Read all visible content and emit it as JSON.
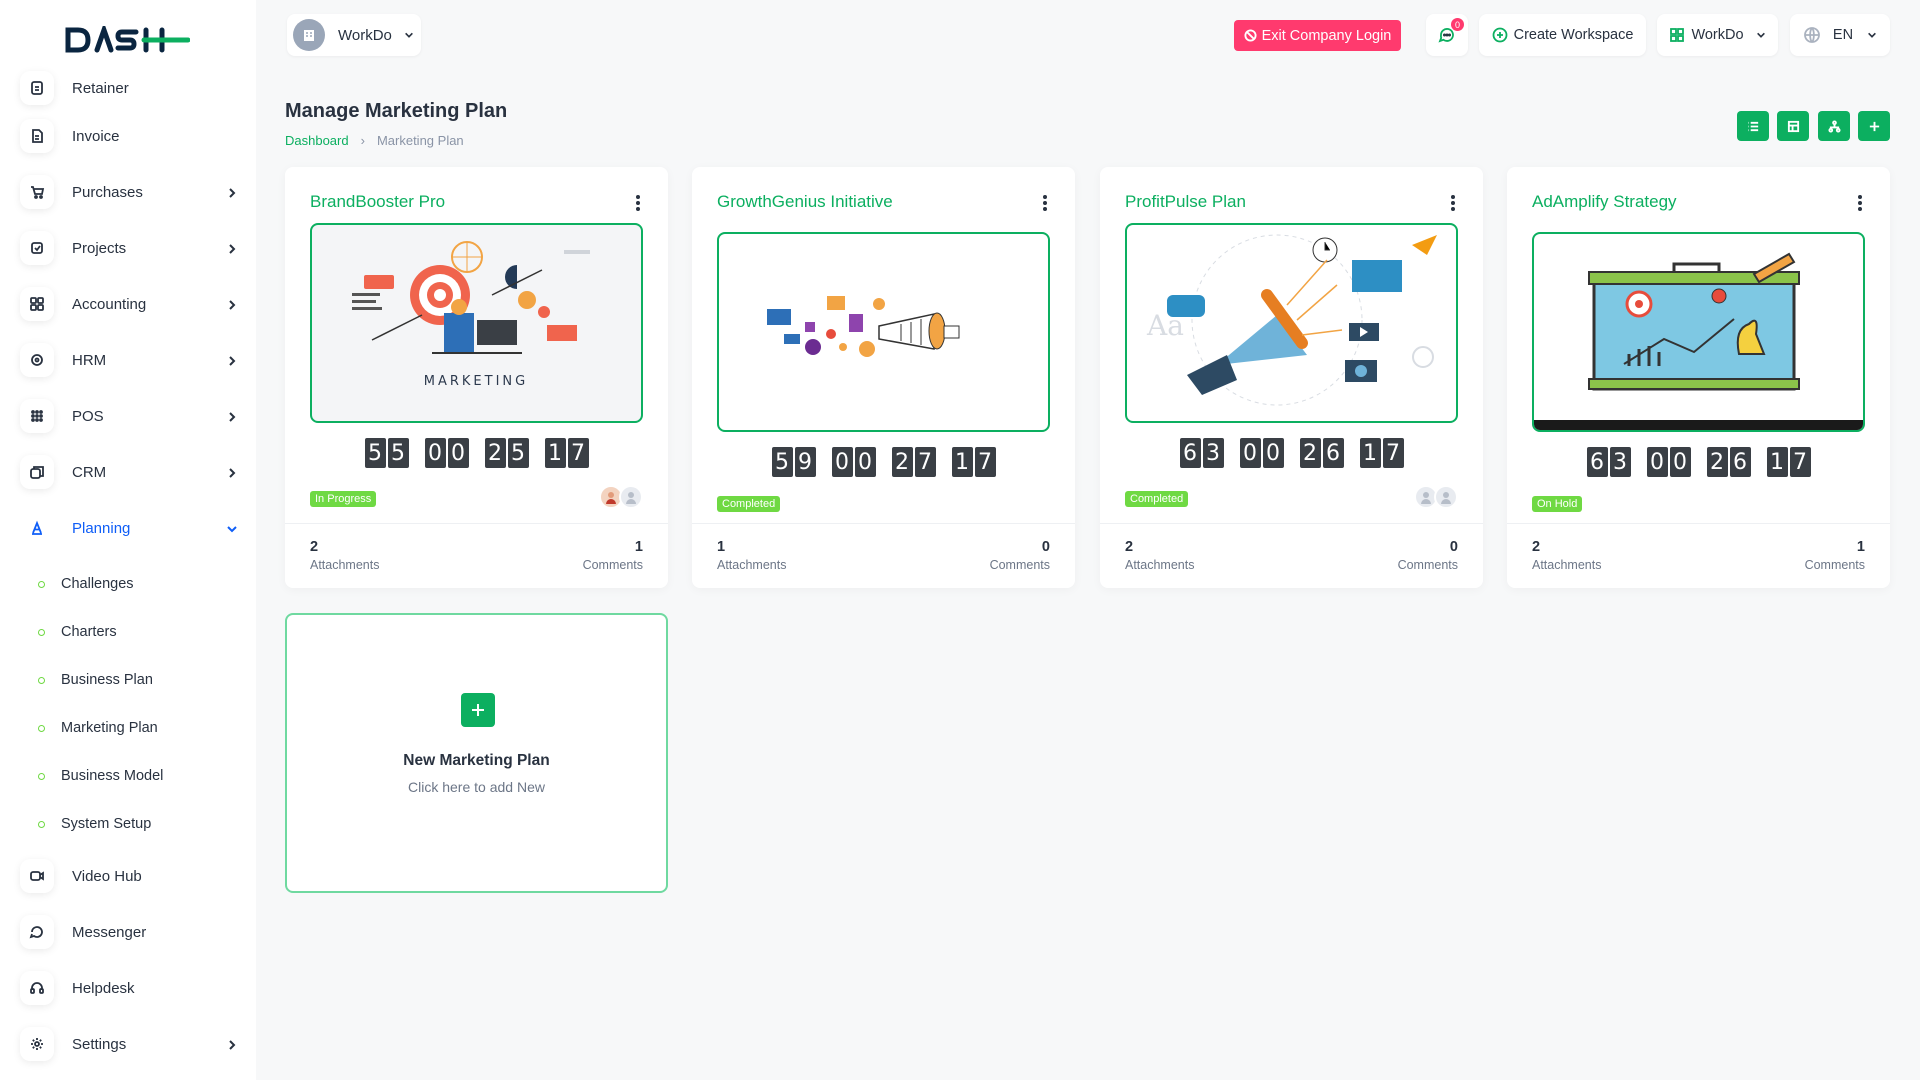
{
  "brand": {
    "logo_text": "DASH"
  },
  "sidebar": {
    "items": [
      {
        "label": "Retainer",
        "icon": "retainer-icon"
      },
      {
        "label": "Invoice",
        "icon": "invoice-icon"
      },
      {
        "label": "Purchases",
        "icon": "cart-icon"
      },
      {
        "label": "Projects",
        "icon": "projects-icon"
      },
      {
        "label": "Accounting",
        "icon": "accounting-icon"
      },
      {
        "label": "HRM",
        "icon": "hrm-icon"
      },
      {
        "label": "POS",
        "icon": "pos-icon"
      },
      {
        "label": "CRM",
        "icon": "crm-icon"
      },
      {
        "label": "Planning",
        "icon": "planning-icon"
      }
    ],
    "planning_sub": [
      {
        "label": "Challenges"
      },
      {
        "label": "Charters"
      },
      {
        "label": "Business Plan"
      },
      {
        "label": "Marketing Plan"
      },
      {
        "label": "Business Model"
      },
      {
        "label": "System Setup"
      }
    ],
    "bottom_items": [
      {
        "label": "Video Hub",
        "icon": "video-icon"
      },
      {
        "label": "Messenger",
        "icon": "messenger-icon"
      },
      {
        "label": "Helpdesk",
        "icon": "headset-icon"
      },
      {
        "label": "Settings",
        "icon": "gear-icon"
      }
    ]
  },
  "header": {
    "workspace": "WorkDo",
    "exit_label": "Exit Company Login",
    "notification_count": "0",
    "create_workspace": "Create Workspace",
    "workspace_menu": "WorkDo",
    "language": "EN"
  },
  "page": {
    "title": "Manage Marketing Plan",
    "breadcrumb": {
      "home": "Dashboard",
      "current": "Marketing Plan"
    }
  },
  "cards": [
    {
      "title": "BrandBooster Pro",
      "countdown": [
        "55",
        "00",
        "25",
        "17"
      ],
      "status": "In Progress",
      "attachments_count": "2",
      "attachments_label": "Attachments",
      "comments_count": "1",
      "comments_label": "Comments",
      "image_caption": "MARKETING"
    },
    {
      "title": "GrowthGenius Initiative",
      "countdown": [
        "59",
        "00",
        "27",
        "17"
      ],
      "status": "Completed",
      "attachments_count": "1",
      "attachments_label": "Attachments",
      "comments_count": "0",
      "comments_label": "Comments"
    },
    {
      "title": "ProfitPulse Plan",
      "countdown": [
        "63",
        "00",
        "26",
        "17"
      ],
      "status": "Completed",
      "attachments_count": "2",
      "attachments_label": "Attachments",
      "comments_count": "0",
      "comments_label": "Comments"
    },
    {
      "title": "AdAmplify Strategy",
      "countdown": [
        "63",
        "00",
        "26",
        "17"
      ],
      "status": "On Hold",
      "attachments_count": "2",
      "attachments_label": "Attachments",
      "comments_count": "1",
      "comments_label": "Comments"
    }
  ],
  "new_card": {
    "title": "New Marketing Plan",
    "subtitle": "Click here to add New"
  },
  "colors": {
    "accent": "#0caf60",
    "status_green": "#6fd943",
    "danger": "#ff3a6e"
  }
}
